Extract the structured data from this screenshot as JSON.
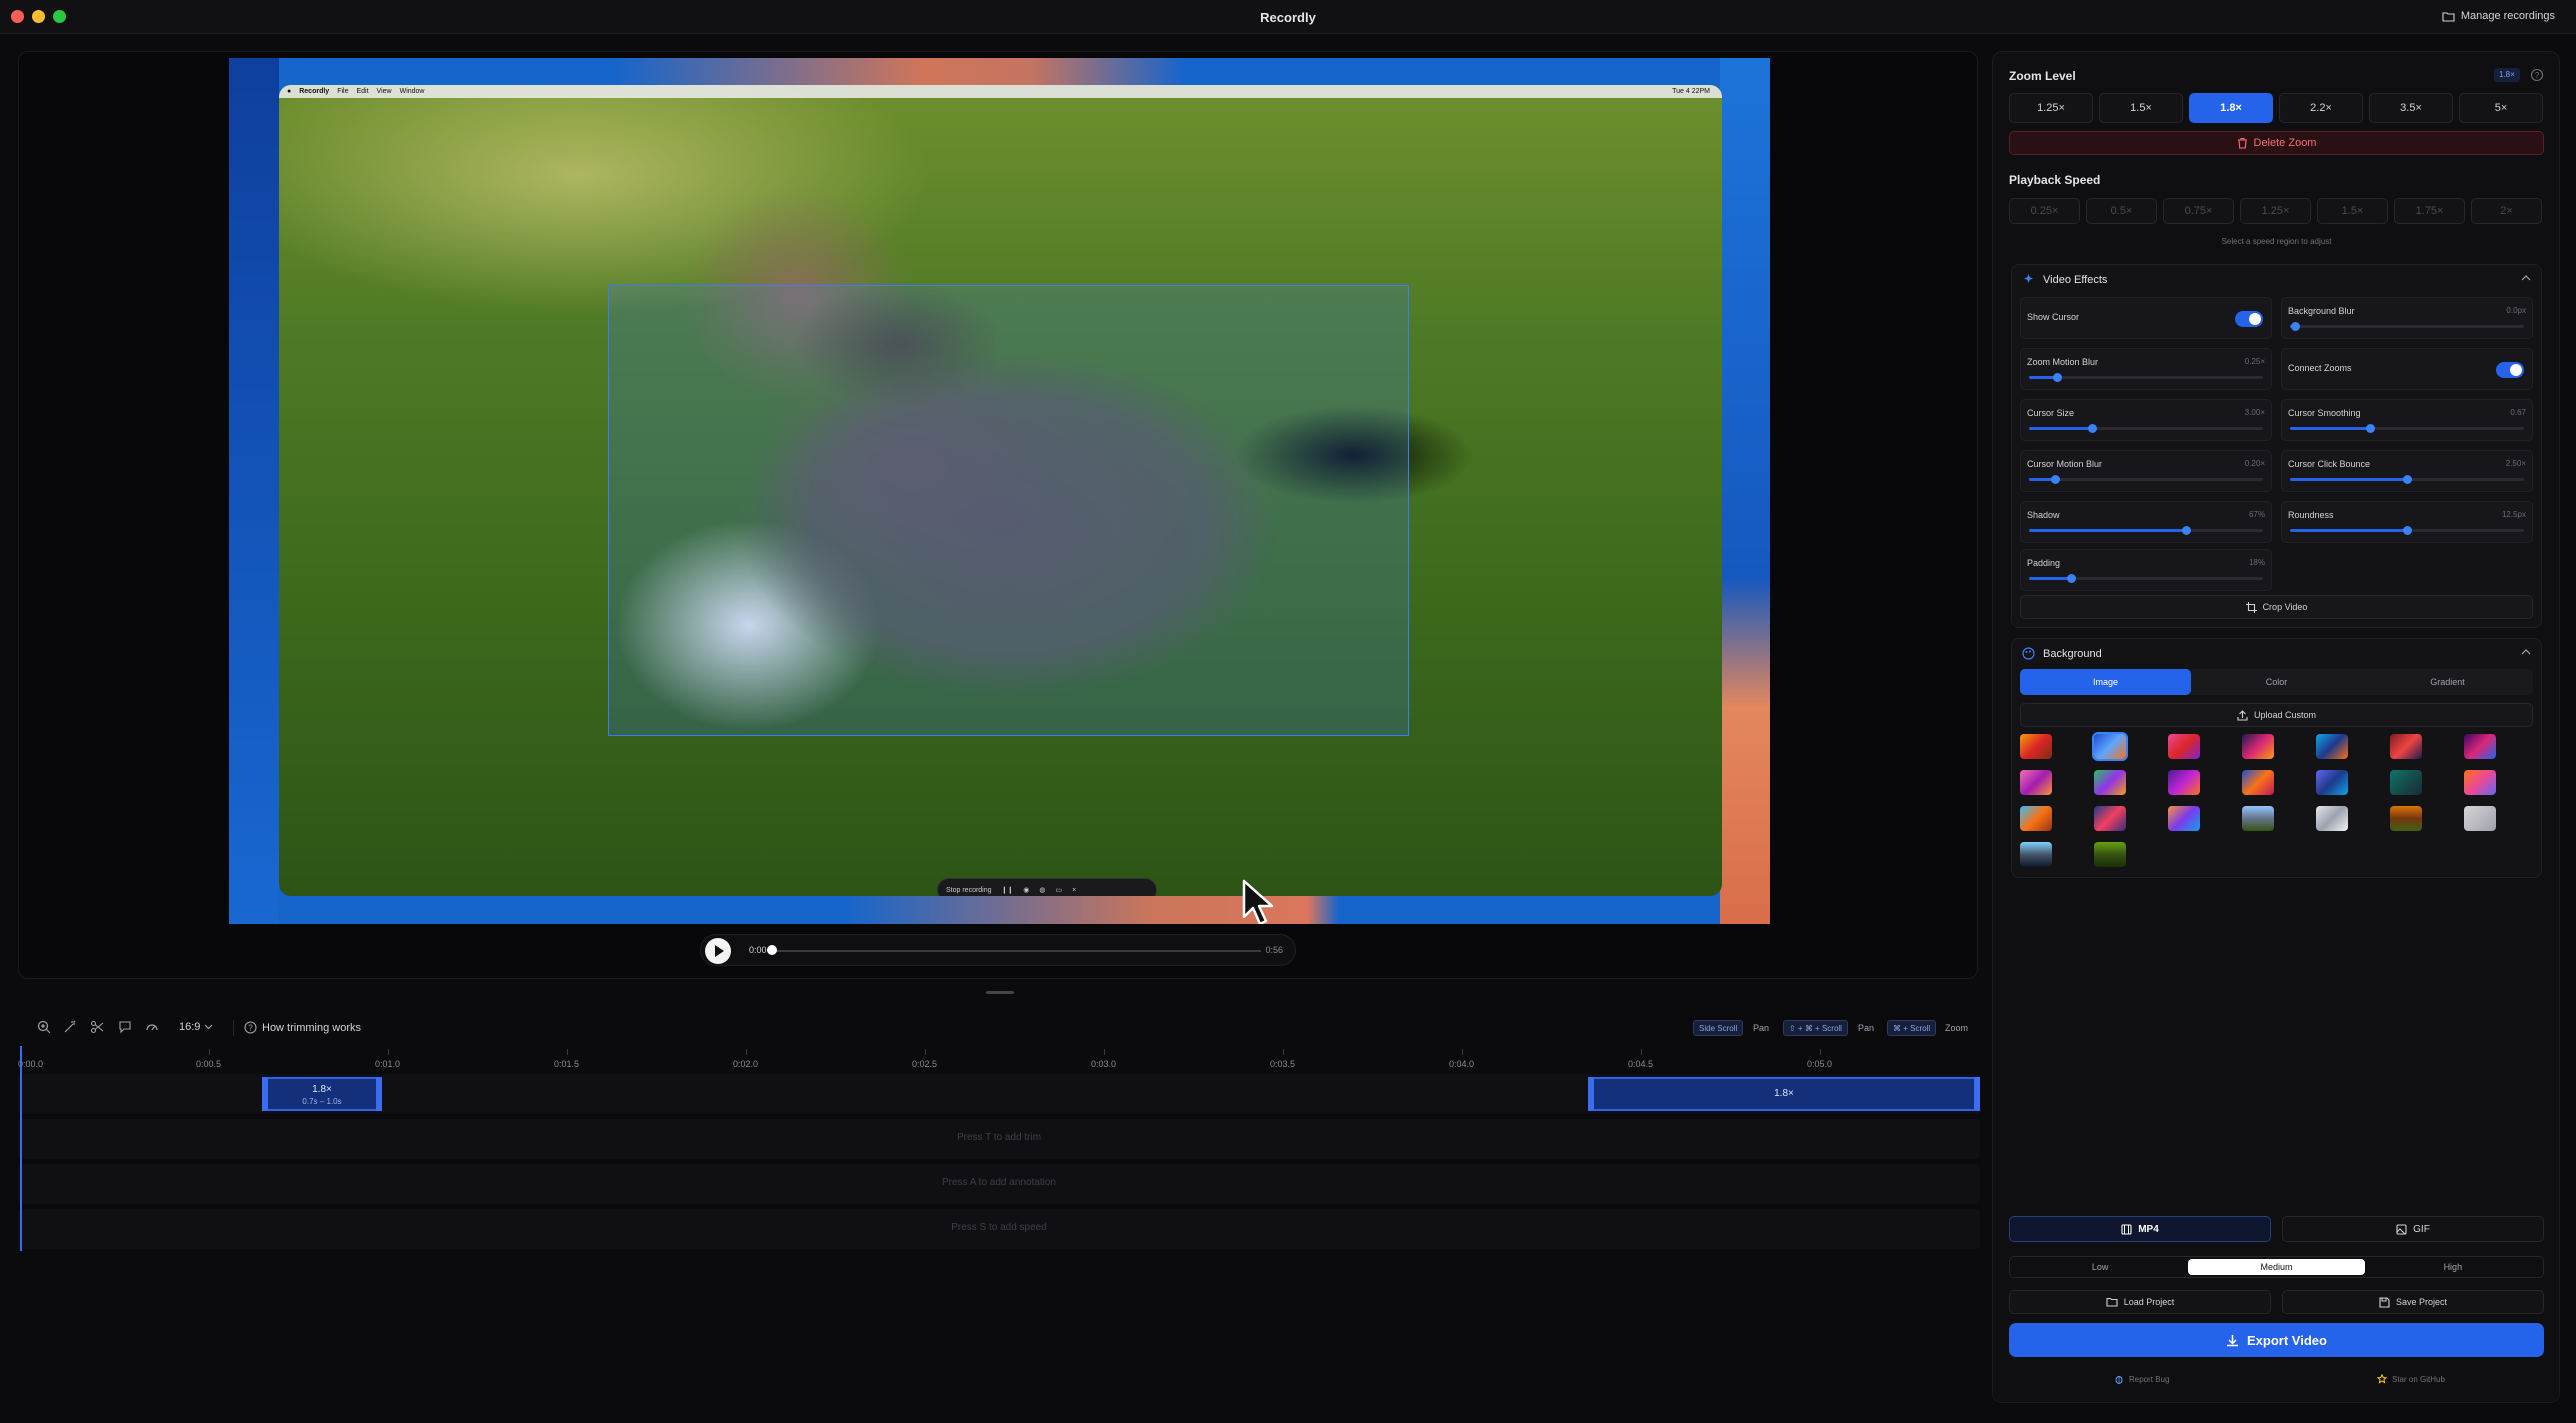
{
  "window": {
    "title": "Recordly",
    "manage_label": "Manage recordings"
  },
  "screen": {
    "menubar": {
      "app": "Recordly",
      "items": [
        "File",
        "Edit",
        "View",
        "Window"
      ],
      "clock": "Tue 4 22PM"
    },
    "recorder_label": "Stop recording"
  },
  "player": {
    "current_time": "0:00",
    "total_time": "0:56"
  },
  "timeline": {
    "aspect_ratio": "16:9",
    "how_label": "How trimming works",
    "shortcuts": [
      {
        "key": "Side Scroll",
        "action": "Pan"
      },
      {
        "key": "⇧ + ⌘ + Scroll",
        "action": "Pan"
      },
      {
        "key": "⌘ + Scroll",
        "action": "Zoom"
      }
    ],
    "ticks": [
      "0:00.0",
      "0:00.5",
      "0:01.0",
      "0:01.5",
      "0:02.0",
      "0:02.5",
      "0:03.0",
      "0:03.5",
      "0:04.0",
      "0:04.5",
      "0:05.0"
    ],
    "zoom_segments": [
      {
        "label": "1.8×",
        "sub": "0.7s – 1.0s"
      },
      {
        "label": "1.8×",
        "sub": ""
      }
    ],
    "lane_hints": [
      "Press T to add trim",
      "Press A to add annotation",
      "Press S to add speed"
    ]
  },
  "zoom": {
    "title": "Zoom Level",
    "badge": "1.8×",
    "levels": [
      "1.25×",
      "1.5×",
      "1.8×",
      "2.2×",
      "3.5×",
      "5×"
    ],
    "selected_index": 2,
    "delete_label": "Delete Zoom"
  },
  "speed": {
    "title": "Playback Speed",
    "levels": [
      "0.25×",
      "0.5×",
      "0.75×",
      "1.25×",
      "1.5×",
      "1.75×",
      "2×"
    ],
    "hint": "Select a speed region to adjust"
  },
  "effects": {
    "title": "Video Effects",
    "controls": [
      {
        "label": "Show Cursor",
        "value": "",
        "toggle": true,
        "on": true,
        "level": null
      },
      {
        "label": "Background Blur",
        "value": "0.0px",
        "toggle": false,
        "level": 0.02
      },
      {
        "label": "Zoom Motion Blur",
        "value": "0.25×",
        "toggle": false,
        "level": 0.12
      },
      {
        "label": "Connect Zooms",
        "value": "",
        "toggle": true,
        "on": true,
        "level": null
      },
      {
        "label": "Cursor Size",
        "value": "3.00×",
        "toggle": false,
        "level": 0.27
      },
      {
        "label": "Cursor Smoothing",
        "value": "0.67",
        "toggle": false,
        "level": 0.34
      },
      {
        "label": "Cursor Motion Blur",
        "value": "0.20×",
        "toggle": false,
        "level": 0.11
      },
      {
        "label": "Cursor Click Bounce",
        "value": "2.50×",
        "toggle": false,
        "level": 0.5
      },
      {
        "label": "Shadow",
        "value": "67%",
        "toggle": false,
        "level": 0.67
      },
      {
        "label": "Roundness",
        "value": "12.5px",
        "toggle": false,
        "level": 0.5
      },
      {
        "label": "Padding",
        "value": "18%",
        "toggle": false,
        "level": 0.18
      }
    ],
    "crop_label": "Crop Video"
  },
  "background": {
    "title": "Background",
    "tabs": [
      "Image",
      "Color",
      "Gradient"
    ],
    "selected_tab": 0,
    "upload_label": "Upload Custom"
  },
  "export": {
    "formats": [
      "MP4",
      "GIF"
    ],
    "selected_format": 0,
    "qualities": [
      "Low",
      "Medium",
      "High"
    ],
    "selected_quality": 1,
    "load_label": "Load Project",
    "save_label": "Save Project",
    "export_label": "Export Video",
    "report_label": "Report Bug",
    "star_label": "Star on GitHub"
  },
  "colors": {
    "accent": "#2563eb",
    "danger": "#f87171",
    "bg": "#0b0b0e"
  }
}
